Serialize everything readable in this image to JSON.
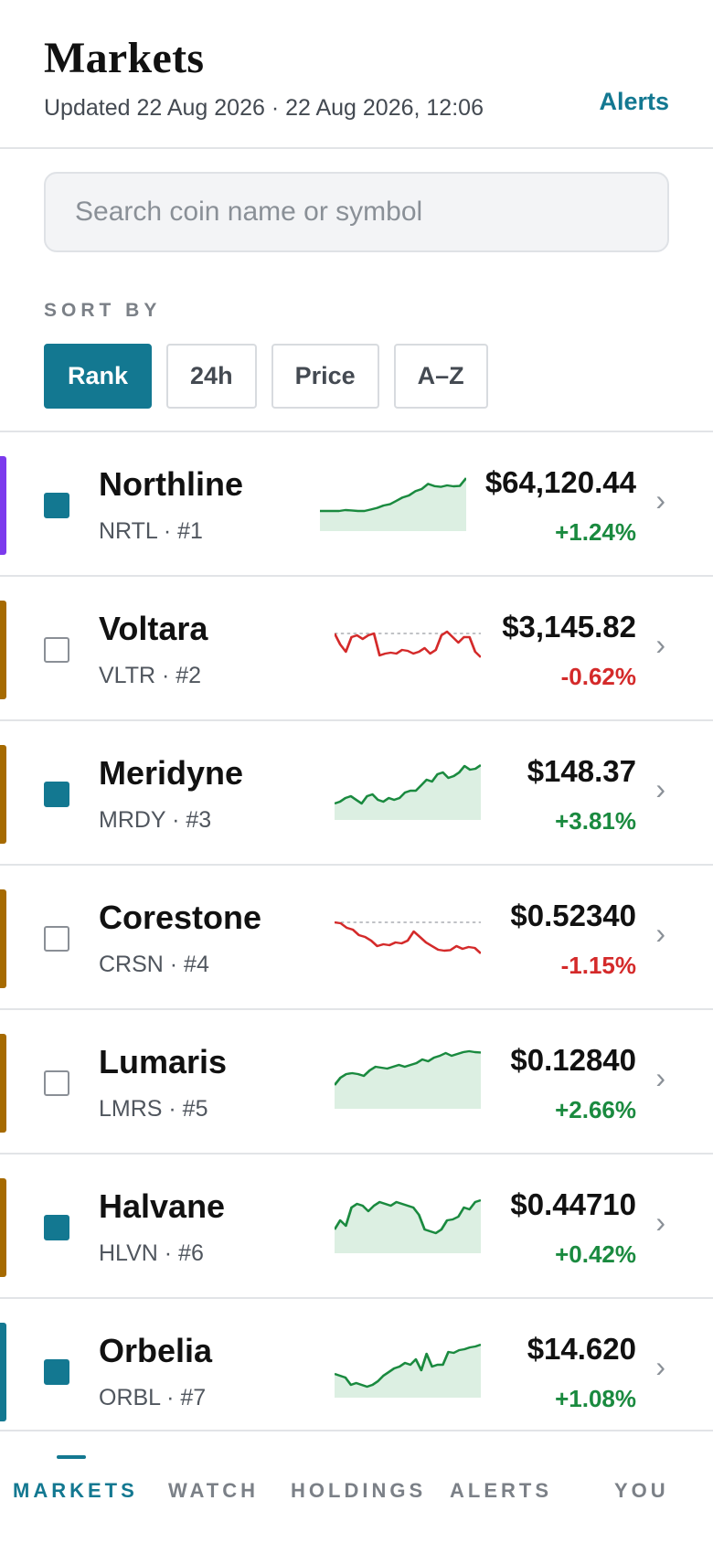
{
  "header": {
    "title": "Markets",
    "updated": "Updated 22 Aug 2026 · 22 Aug 2026, 12:06",
    "alerts_label": "Alerts"
  },
  "search": {
    "placeholder": "Search coin name or symbol",
    "value": ""
  },
  "sort": {
    "label": "SORT BY",
    "options": [
      {
        "label": "Rank",
        "active": true
      },
      {
        "label": "24h",
        "active": false
      },
      {
        "label": "Price",
        "active": false
      },
      {
        "label": "A–Z",
        "active": false
      }
    ]
  },
  "colors": {
    "accent": "#137891",
    "positive": "#1a8a3f",
    "negative": "#d42a2a",
    "purple": "#7c3aed",
    "amber": "#a66a00",
    "teal": "#137891"
  },
  "coins": [
    {
      "name": "Northline",
      "sub": "NRTL · #1",
      "price": "$64,120.44",
      "change": "+1.24%",
      "direction": "up",
      "watched": true,
      "accent": "#7c3aed",
      "spark": [
        10,
        10,
        10,
        10,
        10.5,
        10.3,
        10,
        10,
        10.8,
        11.7,
        13,
        13.7,
        15.5,
        17.4,
        18.5,
        20.8,
        22,
        24.8,
        23.6,
        23.2,
        24,
        23.5,
        23.7,
        28
      ]
    },
    {
      "name": "Voltara",
      "sub": "VLTR · #2",
      "price": "$3,145.82",
      "change": "-0.62%",
      "direction": "down",
      "watched": false,
      "accent": "#a66a00",
      "spark": [
        22,
        16,
        12,
        20,
        21,
        19,
        21,
        22,
        10,
        11,
        11.5,
        11,
        13,
        12.5,
        11,
        12,
        14,
        11,
        13,
        21,
        23,
        20,
        17,
        20,
        20,
        12,
        9
      ]
    },
    {
      "name": "Meridyne",
      "sub": "MRDY · #3",
      "price": "$148.37",
      "change": "+3.81%",
      "direction": "up",
      "watched": true,
      "accent": "#a66a00",
      "spark": [
        8,
        9,
        11,
        12,
        10,
        8,
        12,
        13,
        10,
        9,
        11,
        10,
        11,
        14,
        15,
        15,
        18,
        21,
        20,
        24,
        25,
        22,
        23,
        25,
        28.5,
        26.5,
        27,
        29
      ]
    },
    {
      "name": "Corestone",
      "sub": "CRSN · #4",
      "price": "$0.52340",
      "change": "-1.15%",
      "direction": "down",
      "watched": false,
      "accent": "#a66a00",
      "spark": [
        22,
        21.5,
        19,
        18,
        15,
        14,
        12,
        9,
        10,
        9.5,
        11,
        10.5,
        12,
        17,
        14,
        11,
        9,
        7,
        6.5,
        6.8,
        9,
        7.5,
        8.5,
        8,
        5
      ]
    },
    {
      "name": "Lumaris",
      "sub": "LMRS · #5",
      "price": "$0.12840",
      "change": "+2.66%",
      "direction": "up",
      "watched": false,
      "accent": "#a66a00",
      "spark": [
        12,
        16,
        18,
        18.5,
        18,
        17,
        20,
        22,
        21.5,
        21,
        22,
        23,
        22,
        23,
        24,
        26,
        25,
        27,
        28,
        29.5,
        28,
        29,
        30,
        30.5,
        30,
        29.8
      ]
    },
    {
      "name": "Halvane",
      "sub": "HLVN · #6",
      "price": "$0.44710",
      "change": "+0.42%",
      "direction": "up",
      "watched": true,
      "accent": "#a66a00",
      "spark": [
        12,
        17,
        14,
        24,
        26,
        25,
        22,
        25,
        27,
        26,
        25,
        27,
        26,
        25,
        24,
        20,
        12,
        11,
        10,
        12,
        17,
        17.5,
        19,
        24,
        23,
        27,
        28
      ]
    },
    {
      "name": "Orbelia",
      "sub": "ORBL · #7",
      "price": "$14.620",
      "change": "+1.08%",
      "direction": "up",
      "watched": true,
      "accent": "#137891",
      "spark": [
        12,
        11,
        10,
        6,
        7,
        6,
        5,
        6,
        8,
        11,
        13,
        15,
        16,
        18,
        17,
        20,
        14,
        23,
        16,
        17,
        17,
        24,
        23.5,
        25,
        25.5,
        26.5,
        27,
        28
      ]
    }
  ],
  "bottom_nav": {
    "items": [
      {
        "label": "MARKETS",
        "active": true
      },
      {
        "label": "WATCH",
        "active": false
      },
      {
        "label": "HOLDINGS",
        "active": false
      },
      {
        "label": "ALERTS",
        "active": false
      },
      {
        "label": "YOU",
        "active": false
      }
    ]
  }
}
